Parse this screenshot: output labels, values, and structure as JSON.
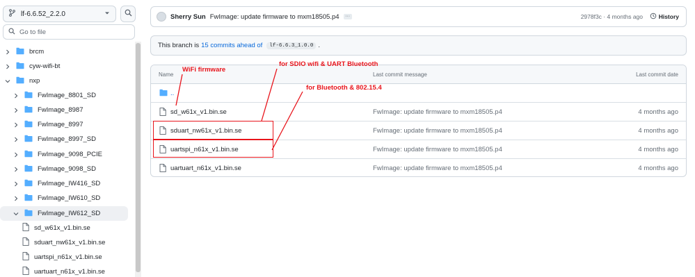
{
  "sidebar": {
    "branch": "lf-6.6.52_2.2.0",
    "search_placeholder": "Go to file",
    "tree": [
      {
        "label": "brcm",
        "type": "folder",
        "expanded": false
      },
      {
        "label": "cyw-wifi-bt",
        "type": "folder",
        "expanded": false
      },
      {
        "label": "nxp",
        "type": "folder",
        "expanded": true
      },
      {
        "label": "FwImage_8801_SD",
        "type": "folder",
        "expanded": false
      },
      {
        "label": "FwImage_8987",
        "type": "folder",
        "expanded": false
      },
      {
        "label": "FwImage_8997",
        "type": "folder",
        "expanded": false
      },
      {
        "label": "FwImage_8997_SD",
        "type": "folder",
        "expanded": false
      },
      {
        "label": "FwImage_9098_PCIE",
        "type": "folder",
        "expanded": false
      },
      {
        "label": "FwImage_9098_SD",
        "type": "folder",
        "expanded": false
      },
      {
        "label": "FwImage_IW416_SD",
        "type": "folder",
        "expanded": false
      },
      {
        "label": "FwImage_IW610_SD",
        "type": "folder",
        "expanded": false
      },
      {
        "label": "FwImage_IW612_SD",
        "type": "folder",
        "expanded": true,
        "selected": true
      },
      {
        "label": "sd_w61x_v1.bin.se",
        "type": "file"
      },
      {
        "label": "sduart_nw61x_v1.bin.se",
        "type": "file"
      },
      {
        "label": "uartspi_n61x_v1.bin.se",
        "type": "file"
      },
      {
        "label": "uartuart_n61x_v1.bin.se",
        "type": "file"
      }
    ]
  },
  "commit": {
    "author": "Sherry Sun",
    "message": "FwImage: update firmware to mxm18505.p4",
    "hash_time": "2978f3c · 4 months ago",
    "history_label": "History"
  },
  "ahead_banner": {
    "prefix": "This branch is",
    "link": "15 commits ahead of",
    "branch_code": "lf-6.6.3_1.0.0",
    "suffix": "."
  },
  "file_table": {
    "headers": {
      "name": "Name",
      "message": "Last commit message",
      "date": "Last commit date"
    },
    "parent": "..",
    "rows": [
      {
        "name": "sd_w61x_v1.bin.se",
        "message": "FwImage: update firmware to mxm18505.p4",
        "date": "4 months ago"
      },
      {
        "name": "sduart_nw61x_v1.bin.se",
        "message": "FwImage: update firmware to mxm18505.p4",
        "date": "4 months ago"
      },
      {
        "name": "uartspi_n61x_v1.bin.se",
        "message": "FwImage: update firmware to mxm18505.p4",
        "date": "4 months ago"
      },
      {
        "name": "uartuart_n61x_v1.bin.se",
        "message": "FwImage: update firmware to mxm18505.p4",
        "date": "4 months ago"
      }
    ]
  },
  "annotations": {
    "wifi": "WiFi firmware",
    "sdio": "for SDIO wifi & UART Bluetooth",
    "bt": "for Bluetooth & 802.15.4",
    "color": "#e8141b"
  },
  "colors": {
    "link": "#0969da",
    "folder": "#54aeff",
    "border": "#d0d7de",
    "muted": "#656d76"
  }
}
